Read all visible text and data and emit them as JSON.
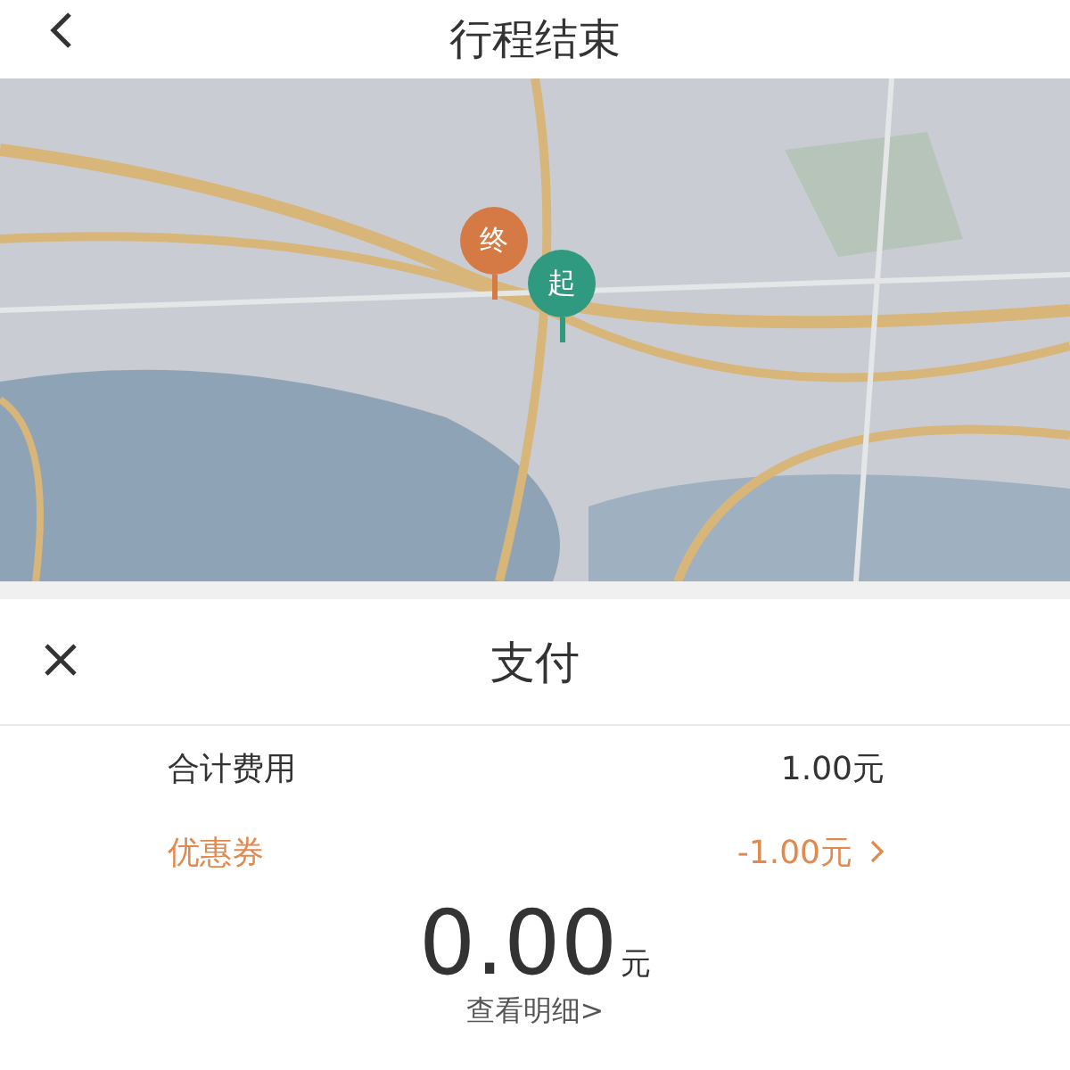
{
  "header": {
    "title": "行程结束"
  },
  "map": {
    "pins": [
      {
        "label": "终",
        "color": "#d67a45"
      },
      {
        "label": "起",
        "color": "#2f9a80"
      }
    ]
  },
  "payment": {
    "title": "支付",
    "rows": [
      {
        "kind": "total",
        "label": "合计费用",
        "value": "1.00元"
      },
      {
        "kind": "coupon",
        "label": "优惠券",
        "value": "-1.00元"
      }
    ],
    "amount": "0.00",
    "unit": "元",
    "detail_link": "查看明细>"
  }
}
